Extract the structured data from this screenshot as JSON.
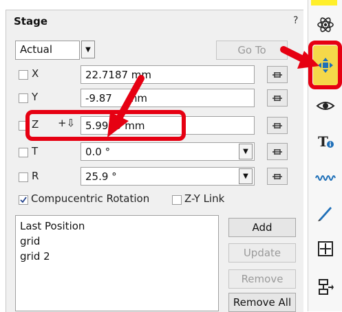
{
  "stage": {
    "title": "Stage",
    "help": "?",
    "mode_select": "Actual",
    "goto_label": "Go To",
    "axes": [
      {
        "label": "X",
        "value": "22.7187 mm"
      },
      {
        "label": "Y",
        "value": "-9.87",
        "value_tail": "mm"
      },
      {
        "label": "Z",
        "value": "5.9999 mm",
        "indicator": "+⇩"
      },
      {
        "label": "T",
        "value": "0.0 °"
      },
      {
        "label": "R",
        "value": "25.9 °"
      }
    ],
    "options": {
      "compucentric_label": "Compucentric Rotation",
      "compucentric_checked": true,
      "zylink_label": "Z-Y Link",
      "zylink_checked": false
    },
    "positions": [
      "Last Position",
      "grid",
      "grid 2"
    ],
    "buttons": {
      "add": "Add",
      "update": "Update",
      "remove": "Remove",
      "remove_all": "Remove All"
    }
  },
  "sidebar_icons": [
    "atom-icon",
    "stage-move-icon",
    "eye-icon",
    "text-info-icon",
    "wave-icon",
    "pen-icon",
    "crosshair-grid-icon",
    "flow-icon"
  ],
  "colors": {
    "highlight": "#e60012",
    "yellow": "#ffef2a",
    "active_icon_bg": "#f5d84a"
  }
}
